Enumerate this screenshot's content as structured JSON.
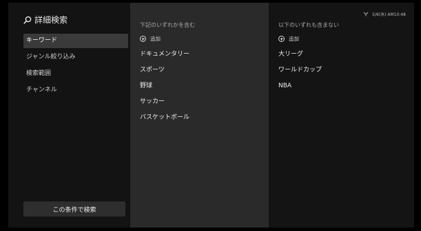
{
  "title": "詳細検索",
  "status": {
    "datetime": "5/6(水) AM10:48"
  },
  "nav": {
    "items": [
      {
        "label": "キーワード"
      },
      {
        "label": "ジャンル絞り込み"
      },
      {
        "label": "検索範囲"
      },
      {
        "label": "チャンネル"
      }
    ],
    "active_index": 0
  },
  "search_button": {
    "label": "この条件で検索"
  },
  "include": {
    "header": "下記のいずれかを含む",
    "add_label": "追加",
    "keywords": [
      "ドキュメンタリー",
      "スポーツ",
      "野球",
      "サッカー",
      "バスケットボール"
    ]
  },
  "exclude": {
    "header": "以下のいずれも含まない",
    "add_label": "追加",
    "keywords": [
      "大リーグ",
      "ワールドカップ",
      "NBA"
    ]
  },
  "colors": {
    "background": "#000000",
    "panel": "#121212",
    "include_column": "#2a2a2a",
    "active_nav": "#3a3a3a",
    "button": "#2e2e2e"
  }
}
